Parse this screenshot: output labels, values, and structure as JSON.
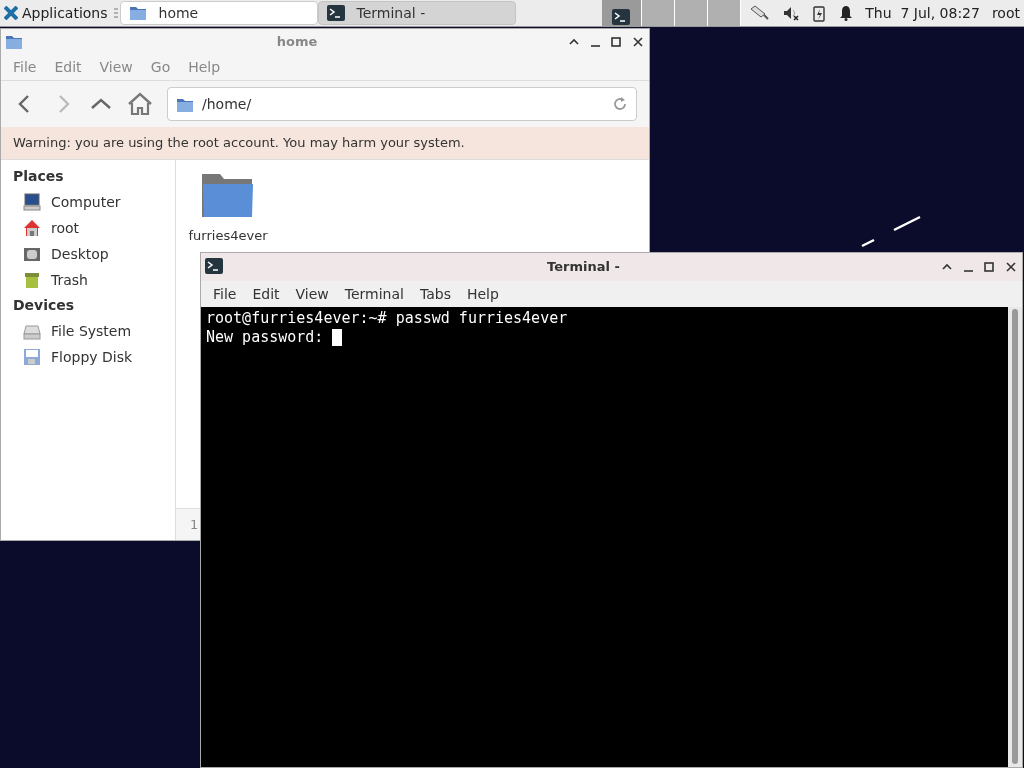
{
  "panel": {
    "applications": "Applications",
    "tasks": [
      {
        "label": "home",
        "kind": "folder",
        "selected": true
      },
      {
        "label": "Terminal -",
        "kind": "terminal",
        "selected": false
      }
    ],
    "clock": "Thu  7 Jul, 08:27",
    "user": "root"
  },
  "file_manager": {
    "title": "home",
    "menu": [
      "File",
      "Edit",
      "View",
      "Go",
      "Help"
    ],
    "path": "/home/",
    "warning": "Warning: you are using the root account. You may harm your system.",
    "sections": [
      {
        "heading": "Places",
        "items": [
          {
            "label": "Computer",
            "kind": "computer"
          },
          {
            "label": "root",
            "kind": "home"
          },
          {
            "label": "Desktop",
            "kind": "desktop"
          },
          {
            "label": "Trash",
            "kind": "trash"
          }
        ]
      },
      {
        "heading": "Devices",
        "items": [
          {
            "label": "File System",
            "kind": "drive"
          },
          {
            "label": "Floppy Disk",
            "kind": "floppy"
          }
        ]
      }
    ],
    "files": [
      {
        "name": "furries4ever"
      }
    ],
    "status": "1"
  },
  "terminal": {
    "title": "Terminal -",
    "menu": [
      "File",
      "Edit",
      "View",
      "Terminal",
      "Tabs",
      "Help"
    ],
    "lines": [
      "root@furries4ever:~# passwd furries4ever",
      "New password: "
    ],
    "cursor": true
  }
}
